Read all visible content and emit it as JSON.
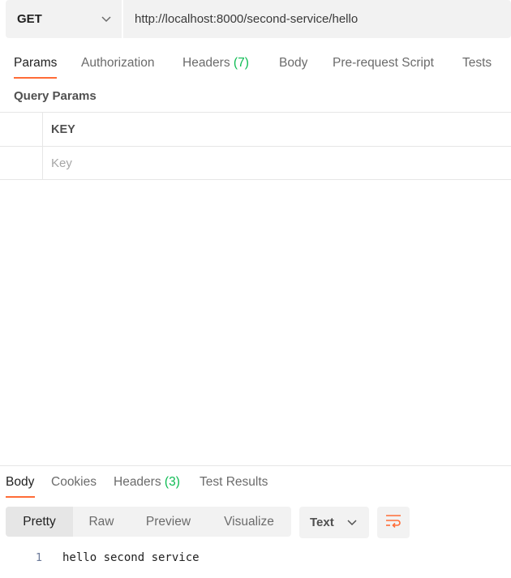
{
  "request": {
    "method": "GET",
    "url": "http://localhost:8000/second-service/hello"
  },
  "request_tabs": [
    {
      "label": "Params",
      "active": true
    },
    {
      "label": "Authorization"
    },
    {
      "label": "Headers",
      "count": "(7)"
    },
    {
      "label": "Body"
    },
    {
      "label": "Pre-request Script"
    },
    {
      "label": "Tests"
    }
  ],
  "query_params": {
    "title": "Query Params",
    "header_key": "KEY",
    "key_placeholder": "Key"
  },
  "response_tabs": [
    {
      "label": "Body",
      "active": true
    },
    {
      "label": "Cookies"
    },
    {
      "label": "Headers",
      "count": "(3)"
    },
    {
      "label": "Test Results"
    }
  ],
  "view_modes": [
    "Pretty",
    "Raw",
    "Preview",
    "Visualize"
  ],
  "format": "Text",
  "response_body": {
    "line_number": "1",
    "text": "hello second service"
  },
  "colors": {
    "accent": "#ff6c37",
    "count_green": "#0cbb52",
    "panel_bg": "#f2f2f2"
  }
}
